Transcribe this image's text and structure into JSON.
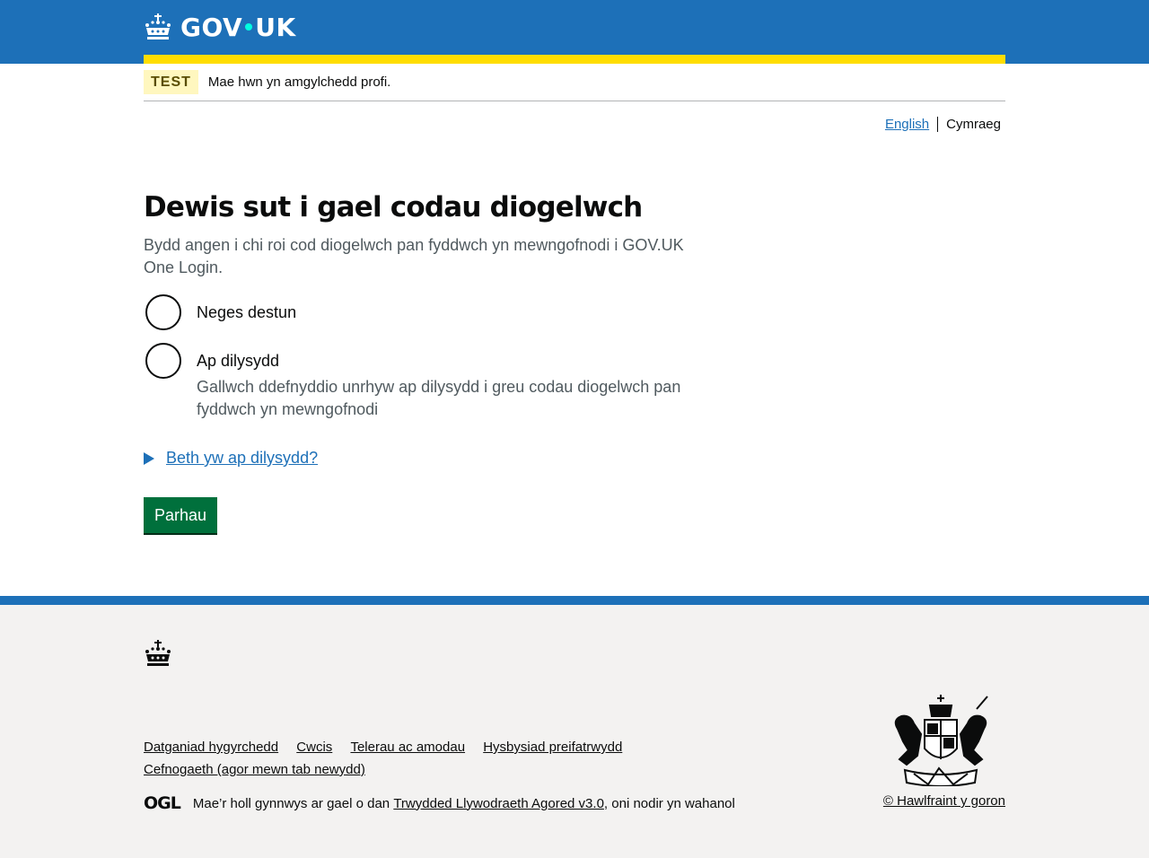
{
  "header": {
    "logo_text_left": "GOV",
    "logo_text_right": "UK",
    "accent_color": "#1d70b8",
    "bar_color": "#ffdd00"
  },
  "phase_banner": {
    "tag": "TEST",
    "text": "Mae hwn yn amgylchedd profi."
  },
  "language": {
    "english": "English",
    "welsh": "Cymraeg"
  },
  "main": {
    "heading": "Dewis sut i gael codau diogelwch",
    "hint": "Bydd angen i chi roi cod diogelwch pan fyddwch yn mewngofnodi i GOV.UK One Login.",
    "options": [
      {
        "label": "Neges destun",
        "hint": ""
      },
      {
        "label": "Ap dilysydd",
        "hint": "Gallwch ddefnyddio unrhyw ap dilysydd i greu codau diogelwch pan fyddwch yn mewngofnodi"
      }
    ],
    "details_summary": "Beth yw ap dilysydd?",
    "continue_button": "Parhau"
  },
  "footer": {
    "links": [
      "Datganiad hygyrchedd",
      "Cwcis",
      "Telerau ac amodau",
      "Hysbysiad preifatrwydd",
      "Cefnogaeth (agor mewn tab newydd)"
    ],
    "ogl_logo": "OGL",
    "licence_prefix": "Mae’r holl gynnwys ar gael o dan ",
    "licence_link": "Trwydded Llywodraeth Agored v3.0",
    "licence_suffix": ", oni nodir yn wahanol",
    "copyright": "© Hawlfraint y goron",
    "crest_motto_left": "DIEU ET",
    "crest_motto_right": "MON DROIT"
  }
}
